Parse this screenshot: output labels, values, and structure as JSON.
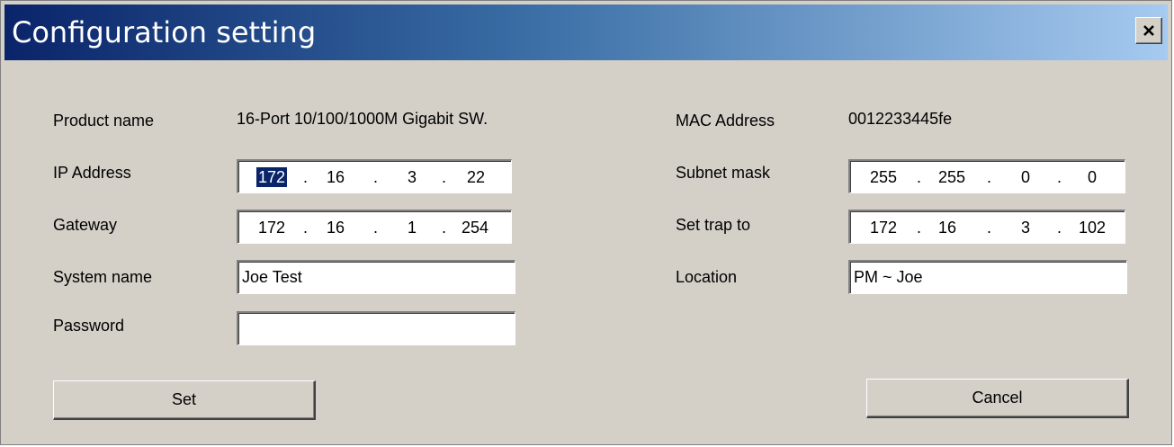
{
  "window": {
    "title": "Configuration setting",
    "close_icon": "close-icon"
  },
  "left": {
    "product_name_label": "Product name",
    "product_name_value": "16-Port 10/100/1000M Gigabit SW.",
    "ip_label": "IP Address",
    "ip": [
      "172",
      "16",
      "3",
      "22"
    ],
    "gateway_label": "Gateway",
    "gateway": [
      "172",
      "16",
      "1",
      "254"
    ],
    "system_name_label": "System name",
    "system_name_value": "Joe Test",
    "password_label": "Password",
    "password_value": ""
  },
  "right": {
    "mac_label": "MAC Address",
    "mac_value": "0012233445fe",
    "subnet_label": "Subnet mask",
    "subnet": [
      "255",
      "255",
      "0",
      "0"
    ],
    "trap_label": "Set trap to",
    "trap": [
      "172",
      "16",
      "3",
      "102"
    ],
    "location_label": "Location",
    "location_value": "PM ~ Joe"
  },
  "buttons": {
    "set": "Set",
    "cancel": "Cancel"
  },
  "ip_separator": "."
}
